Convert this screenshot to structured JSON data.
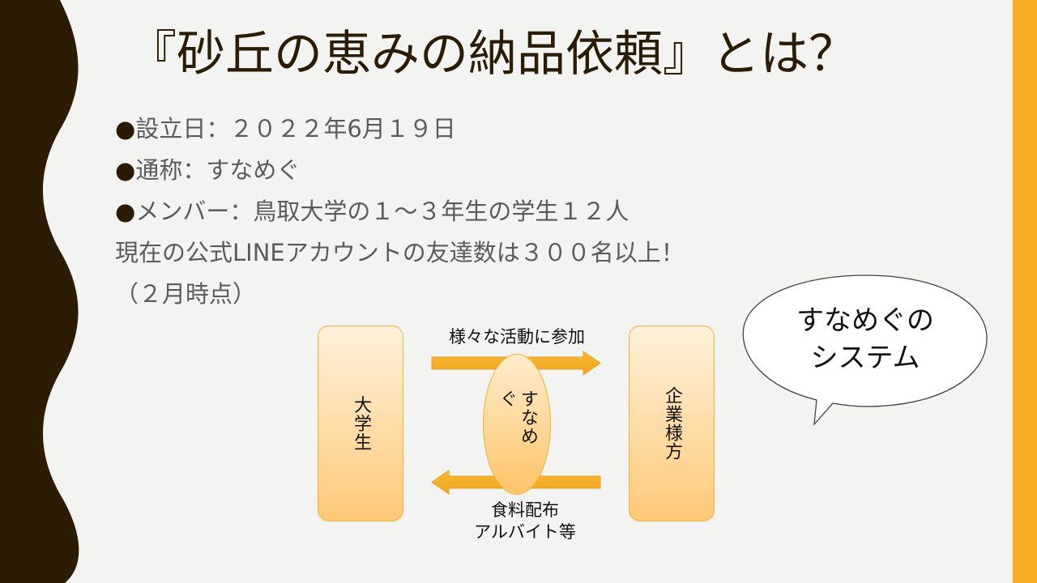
{
  "slide": {
    "title": "『砂丘の恵みの納品依頼』とは？",
    "bullets": [
      {
        "marker": "●",
        "text": "設立日：２０２２年6月１９日"
      },
      {
        "marker": "●",
        "text": "通称：すなめぐ"
      },
      {
        "marker": "●",
        "text": "メンバー：鳥取大学の１～３年生の学生１２人"
      },
      {
        "marker": "",
        "text": "現在の公式LINEアカウントの友達数は３００名以上！"
      },
      {
        "marker": "",
        "text": "（２月時点）"
      }
    ],
    "diagram": {
      "left_node": "大学生",
      "right_node": "企業様方",
      "center_node": "すなめぐ",
      "top_caption": "様々な活動に参加",
      "bottom_caption_line1": "食料配布",
      "bottom_caption_line2": "アルバイト等"
    },
    "callout": {
      "line1": "すなめぐの",
      "line2": "システム"
    }
  },
  "colors": {
    "background": "#f3f3f1",
    "accent_orange": "#f5ae26",
    "dark_brown": "#2b1c06",
    "body_text": "#5b5b5b"
  }
}
